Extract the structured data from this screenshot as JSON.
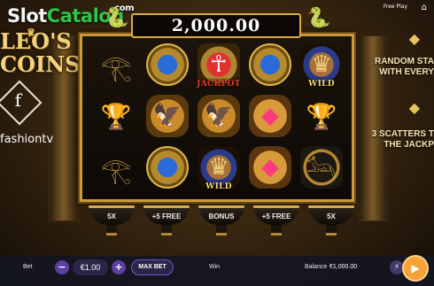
{
  "branding": {
    "watermark_slot": "Slot",
    "watermark_catalog": "Catalog",
    "watermark_com": ".com",
    "title_line1": "LEO'S",
    "title_line2": "COINS",
    "partner_logo_letter": "f",
    "partner_text": "fashiontv"
  },
  "topbar": {
    "free_play": "Free Play",
    "home_icon": "home-icon"
  },
  "jackpot": {
    "amount": "2,000.00"
  },
  "hints": {
    "line1": "RANDOM STA",
    "line2": "WITH EVERY ",
    "line3": "3 SCATTERS T",
    "line4": "THE JACKP"
  },
  "reels": [
    [
      {
        "sym": "eye",
        "icon": "eye-of-horus-icon"
      },
      {
        "sym": "gem",
        "icon": "sapphire-coin-icon"
      },
      {
        "sym": "ankh",
        "icon": "jackpot-ankh-icon",
        "label": "JACKPOT"
      },
      {
        "sym": "gem",
        "icon": "sapphire-coin-icon"
      },
      {
        "sym": "queen",
        "icon": "queen-icon",
        "label": "WILD"
      }
    ],
    [
      {
        "sym": "cup",
        "icon": "golden-chalice-icon"
      },
      {
        "sym": "falcon",
        "icon": "falcon-icon"
      },
      {
        "sym": "falcon",
        "icon": "falcon-icon"
      },
      {
        "sym": "cat",
        "icon": "bastet-cat-icon"
      },
      {
        "sym": "cup",
        "icon": "golden-chalice-icon"
      }
    ],
    [
      {
        "sym": "eye",
        "icon": "eye-of-horus-icon"
      },
      {
        "sym": "gem",
        "icon": "sapphire-coin-icon"
      },
      {
        "sym": "queen",
        "icon": "queen-icon",
        "label": "WILD"
      },
      {
        "sym": "cat",
        "icon": "bastet-cat-icon"
      },
      {
        "sym": "anubis",
        "icon": "anubis-icon"
      }
    ]
  ],
  "bowls": [
    "5X",
    "+5 FREE",
    "BONUS",
    "+5 FREE",
    "5X"
  ],
  "controls": {
    "bet_label": "Bet",
    "bet_value": "€1.00",
    "minus": "−",
    "plus": "+",
    "max_bet": "MAX BET",
    "win_label": "Win",
    "balance_label": "Balance",
    "balance_value": "€1,000.00"
  },
  "colors": {
    "accent_gold": "#d9ab45",
    "button_purple": "#5c3f9e",
    "spin_orange": "#f5a23a"
  }
}
